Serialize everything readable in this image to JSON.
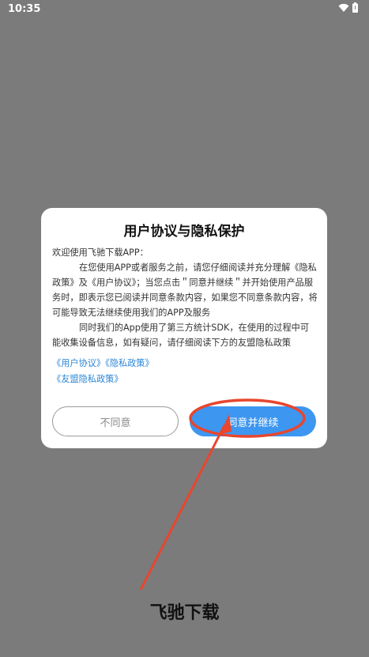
{
  "status_bar": {
    "time": "10:35",
    "wifi_icon": "wifi-icon",
    "battery_icon": "battery-icon"
  },
  "dialog": {
    "title": "用户协议与隐私保护",
    "greeting": "欢迎使用飞驰下载APP：",
    "paragraph1": "在您使用APP或者服务之前，请您仔细阅读并充分理解《隐私政策》及《用户协议》；当您点击＂同意并继续＂并开始使用产品服务时，即表示您已阅读并同意条款内容，如果您不同意条款内容，将可能导致无法继续使用我们的APP及服务",
    "paragraph2": "同时我们的App使用了第三方统计SDK，在使用的过程中可能收集设备信息，如有疑问，请仔细阅读下方的友盟隐私政策",
    "link_user_agreement": "《用户协议》",
    "link_privacy_policy": "《隐私政策》",
    "link_umeng_privacy": "《友盟隐私政策》",
    "disagree_label": "不同意",
    "agree_label": "同意并继续"
  },
  "watermark": "飞驰下载",
  "colors": {
    "overlay": "#7b7b7b",
    "accent": "#3d96f0",
    "link": "#2b86d6",
    "annotation": "#e8462e"
  }
}
